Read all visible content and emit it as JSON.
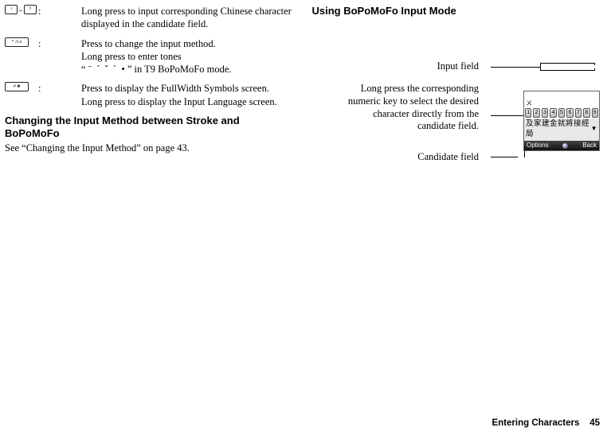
{
  "left": {
    "entry1": {
      "key_a": "1",
      "dash": "-",
      "key_b": "9",
      "text": "Long press to input corresponding Chinese character displayed in the candidate field."
    },
    "entry2": {
      "key": "*",
      "line1": "Press to change the input method.",
      "line2": "Long press to enter tones",
      "line3": "“ ˉ  ˊ  ˇ  ˋ  • ” in T9 BoPoMoFo mode."
    },
    "entry3": {
      "key": "#",
      "line1": "Press to display the FullWidth Symbols screen.",
      "line2": "Long press to display the Input Language screen."
    },
    "heading": "Changing the Input Method between Stroke and BoPoMoFo",
    "subref": "See “Changing the Input Method” on page 43."
  },
  "right": {
    "heading": "Using BoPoMoFo Input Mode",
    "labels": {
      "input": "Input field",
      "longpress": "Long press the corresponding numeric key to select the desired character directly from the candidate field.",
      "candidate": "Candidate field"
    },
    "phone": {
      "tiny": "ㄨ",
      "keys": [
        "1",
        "2",
        "3",
        "4",
        "5",
        "6",
        "7",
        "8",
        "9"
      ],
      "candidates": "及家建金就將接經局",
      "soft_left": "Options",
      "soft_right": "Back"
    }
  },
  "footer": {
    "section": "Entering Characters",
    "page": "45"
  }
}
